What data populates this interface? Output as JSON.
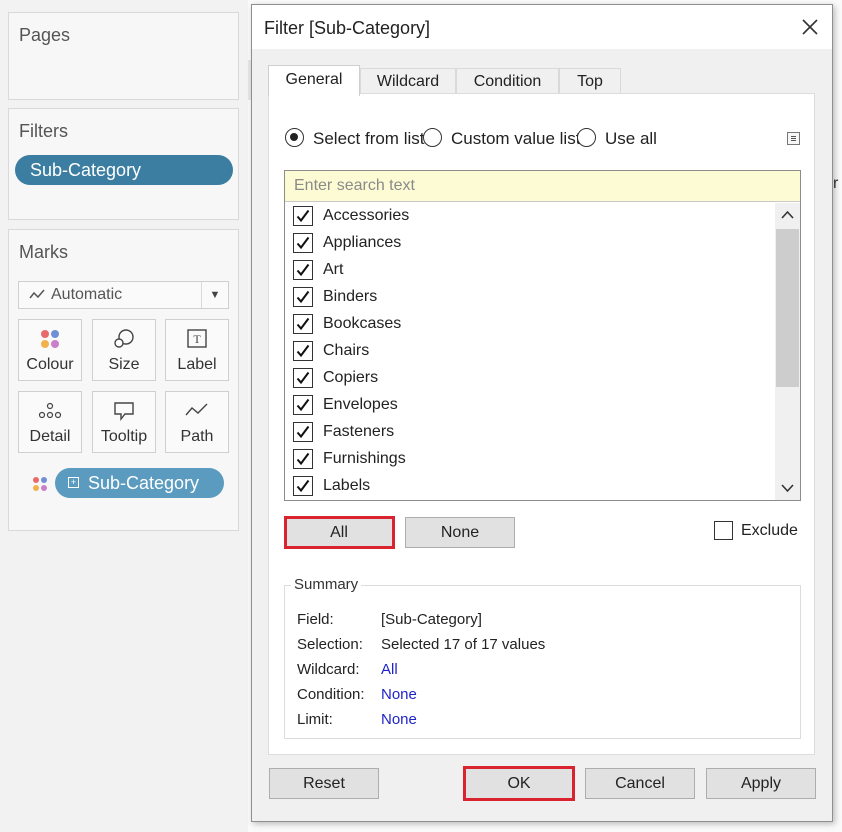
{
  "shelves": {
    "pages_title": "Pages",
    "filters_title": "Filters",
    "filter_pill": "Sub-Category",
    "marks_title": "Marks",
    "mark_type": "Automatic",
    "mark_buttons": [
      "Colour",
      "Size",
      "Label",
      "Detail",
      "Tooltip",
      "Path"
    ],
    "marks_pill": "Sub-Category"
  },
  "dialog": {
    "title": "Filter [Sub-Category]",
    "tabs": [
      "General",
      "Wildcard",
      "Condition",
      "Top"
    ],
    "active_tab": "General",
    "options": {
      "select_from_list": "Select from list",
      "custom_value_list": "Custom value list",
      "use_all": "Use all",
      "selected": "select_from_list"
    },
    "search_placeholder": "Enter search text",
    "items": [
      {
        "label": "Accessories",
        "checked": true
      },
      {
        "label": "Appliances",
        "checked": true
      },
      {
        "label": "Art",
        "checked": true
      },
      {
        "label": "Binders",
        "checked": true
      },
      {
        "label": "Bookcases",
        "checked": true
      },
      {
        "label": "Chairs",
        "checked": true
      },
      {
        "label": "Copiers",
        "checked": true
      },
      {
        "label": "Envelopes",
        "checked": true
      },
      {
        "label": "Fasteners",
        "checked": true
      },
      {
        "label": "Furnishings",
        "checked": true
      },
      {
        "label": "Labels",
        "checked": true
      }
    ],
    "all_button": "All",
    "none_button": "None",
    "exclude_label": "Exclude",
    "exclude_checked": false,
    "summary": {
      "title": "Summary",
      "field_label": "Field:",
      "field_value": "[Sub-Category]",
      "selection_label": "Selection:",
      "selection_value": "Selected 17 of 17 values",
      "wildcard_label": "Wildcard:",
      "wildcard_value": "All",
      "condition_label": "Condition:",
      "condition_value": "None",
      "limit_label": "Limit:",
      "limit_value": "None"
    },
    "footer": {
      "reset": "Reset",
      "ok": "OK",
      "cancel": "Cancel",
      "apply": "Apply"
    }
  },
  "colors": {
    "filter_pill": "#3b7ea1",
    "marks_pill": "#5a9bbf",
    "highlight": "#d9232e",
    "link": "#1f24c8",
    "search_bg": "#fdfbd4"
  }
}
